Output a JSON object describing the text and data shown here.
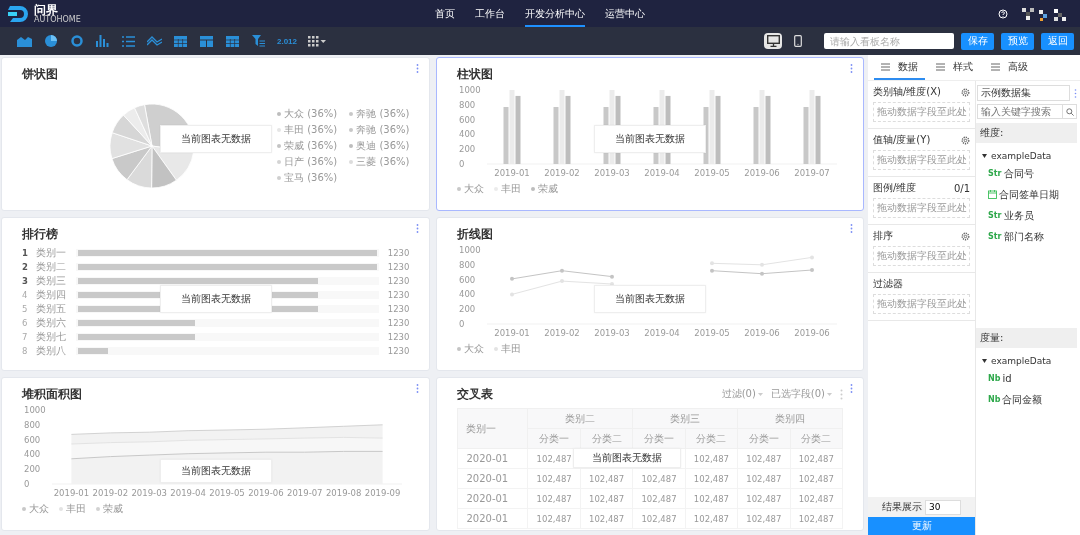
{
  "header": {
    "logo": {
      "title": "问界",
      "subtitle": "AUTOHOME"
    },
    "nav": [
      {
        "label": "首页",
        "selected": false
      },
      {
        "label": "工作台",
        "selected": false
      },
      {
        "label": "开发分析中心",
        "selected": true
      },
      {
        "label": "运营中心",
        "selected": false
      }
    ]
  },
  "toolbar": {
    "chart_types": [
      {
        "kind": "area"
      },
      {
        "kind": "pie"
      },
      {
        "kind": "donut"
      },
      {
        "kind": "bar"
      },
      {
        "kind": "list"
      },
      {
        "kind": "line"
      },
      {
        "kind": "table"
      },
      {
        "kind": "layout"
      },
      {
        "kind": "table"
      },
      {
        "kind": "filter"
      },
      {
        "kind": "number",
        "label": "2.012"
      },
      {
        "kind": "more"
      }
    ],
    "views": [
      {
        "kind": "desktop",
        "selected": true
      },
      {
        "kind": "mobile",
        "selected": false
      }
    ],
    "name_field": {
      "placeholder": "请输入看板名称"
    },
    "buttons": [
      "保存",
      "预览",
      "返回"
    ]
  },
  "panels": [
    {
      "kind": "pie",
      "title": "饼状图",
      "selected": false,
      "no_data": "当前图表无数据",
      "legend": [
        {
          "label": "大众 (36%)",
          "color": "#bdbdbd"
        },
        {
          "label": "奔驰 (36%)",
          "color": "#c8c8c8"
        },
        {
          "label": "丰田 (36%)",
          "color": "#e6e6e6"
        },
        {
          "label": "奔驰 (36%)",
          "color": "#c8c8c8"
        },
        {
          "label": "荣威 (36%)",
          "color": "#c4c4c4"
        },
        {
          "label": "奥迪 (36%)",
          "color": "#bdbdbd"
        },
        {
          "label": "日产 (36%)",
          "color": "#d4d4d4"
        },
        {
          "label": "三菱 (36%)",
          "color": "#dcdcdc"
        },
        {
          "label": "宝马 (36%)",
          "color": "#cfcfcf"
        }
      ]
    },
    {
      "kind": "bar",
      "title": "柱状图",
      "selected": true,
      "no_data": "当前图表无数据",
      "chart_data": {
        "type": "bar",
        "categories": [
          "2019-01",
          "2019-02",
          "2019-03",
          "2019-04",
          "2019-05",
          "2019-06",
          "2019-07"
        ],
        "ylim": [
          0,
          1000
        ],
        "yticks": [
          0,
          200,
          400,
          600,
          800,
          1000
        ],
        "series": [
          {
            "name": "大众",
            "color": "#c8c8c8",
            "values": [
              770,
              770,
              770,
              770,
              770,
              770,
              770
            ]
          },
          {
            "name": "丰田",
            "color": "#ebebeb",
            "values": [
              1000,
              1000,
              1000,
              1000,
              1000,
              1000,
              1000
            ]
          },
          {
            "name": "荣威",
            "color": "#bdbdbd",
            "values": [
              920,
              920,
              920,
              920,
              920,
              920,
              920
            ]
          }
        ]
      }
    },
    {
      "kind": "ranking",
      "title": "排行榜",
      "selected": false,
      "no_data": "当前图表无数据",
      "rows": [
        {
          "rank": "1",
          "label": "类别一",
          "level": 1,
          "value": "1230",
          "top": true
        },
        {
          "rank": "2",
          "label": "类别二",
          "level": 1,
          "value": "1230",
          "top": true
        },
        {
          "rank": "3",
          "label": "类别三",
          "level": 0.8,
          "value": "1230",
          "top": true
        },
        {
          "rank": "4",
          "label": "类别四",
          "level": 0.8,
          "value": "1230",
          "top": false
        },
        {
          "rank": "5",
          "label": "类别五",
          "level": 0.8,
          "value": "1230",
          "top": false
        },
        {
          "rank": "6",
          "label": "类别六",
          "level": 0.39,
          "value": "1230",
          "top": false
        },
        {
          "rank": "7",
          "label": "类别七",
          "level": 0.39,
          "value": "1230",
          "top": false
        },
        {
          "rank": "8",
          "label": "类别八",
          "level": 0.1,
          "value": "1230",
          "top": false
        }
      ]
    },
    {
      "kind": "line",
      "title": "折线图",
      "selected": false,
      "no_data": "当前图表无数据",
      "chart_data": {
        "type": "line",
        "categories": [
          "2019-01",
          "2019-02",
          "2019-03",
          "2019-04",
          "2019-05",
          "2019-06",
          "2019-06"
        ],
        "ylim": [
          0,
          1000
        ],
        "yticks": [
          0,
          200,
          400,
          600,
          800,
          1000
        ],
        "series": [
          {
            "name": "大众",
            "color": "#c4c4c4",
            "values": [
              610,
              720,
              640,
              null,
              720,
              680,
              730
            ]
          },
          {
            "name": "丰田",
            "color": "#e3e3e3",
            "values": [
              400,
              580,
              540,
              null,
              820,
              800,
              900
            ]
          }
        ]
      }
    },
    {
      "kind": "area",
      "title": "堆积面积图",
      "selected": false,
      "no_data": "当前图表无数据",
      "chart_data": {
        "type": "area",
        "categories": [
          "2019-01",
          "2019-02",
          "2019-03",
          "2019-04",
          "2019-05",
          "2019-06",
          "2019-07",
          "2019-08",
          "2019-09"
        ],
        "ylim": [
          0,
          1000
        ],
        "yticks": [
          0,
          200,
          400,
          600,
          800,
          1000
        ],
        "series": [
          {
            "name": "大众",
            "color": "#c8c8c8",
            "values": [
              340,
              370,
              390,
              410,
              420,
              430,
              430,
              440,
              440
            ]
          },
          {
            "name": "丰田",
            "color": "#e3e3e3",
            "values": [
              540,
              560,
              570,
              590,
              600,
              610,
              620,
              630,
              620
            ]
          },
          {
            "name": "荣威",
            "color": "#d2d2d2",
            "values": [
              670,
              690,
              700,
              720,
              730,
              740,
              760,
              780,
              800
            ]
          }
        ]
      }
    },
    {
      "kind": "crosstab",
      "title": "交叉表",
      "selected": false,
      "no_data": "当前图表无数据",
      "filters": [
        "过滤(0)",
        "已选字段(0)"
      ],
      "table": {
        "corner": "类别一",
        "groups": [
          "类别二",
          "类别三",
          "类别四"
        ],
        "columns": [
          "分类一",
          "分类二",
          "分类一",
          "分类二",
          "分类一",
          "分类二"
        ],
        "rows": [
          {
            "label": "2020-01",
            "cells": [
              "102,487",
              null,
              null,
              "102,487",
              "102,487",
              "102,487"
            ]
          },
          {
            "label": "2020-01",
            "cells": [
              "102,487",
              "102,487",
              "102,487",
              "102,487",
              "102,487",
              "102,487"
            ]
          },
          {
            "label": "2020-01",
            "cells": [
              "102,487",
              "102,487",
              "102,487",
              "102,487",
              "102,487",
              "102,487"
            ]
          },
          {
            "label": "2020-01",
            "cells": [
              "102,487",
              "102,487",
              "102,487",
              "102,487",
              "102,487",
              "102,487"
            ]
          }
        ]
      }
    }
  ],
  "config": {
    "tabs": [
      {
        "label": "数据",
        "selected": true
      },
      {
        "label": "样式",
        "selected": false
      },
      {
        "label": "高级",
        "selected": false
      }
    ],
    "sections": [
      {
        "kind": "gear",
        "title": "类别轴/维度(X)",
        "drop": "拖动数据字段至此处"
      },
      {
        "kind": "gear",
        "title": "值轴/度量(Y)",
        "drop": "拖动数据字段至此处"
      },
      {
        "kind": "count",
        "title": "图例/维度",
        "count": "0/1",
        "drop": "拖动数据字段至此处"
      },
      {
        "kind": "gear",
        "title": "排序",
        "drop": "拖动数据字段至此处"
      },
      {
        "kind": "plain",
        "title": "过滤器",
        "drop": "拖动数据字段至此处"
      }
    ],
    "result": {
      "label": "结果展示",
      "value": "30"
    },
    "update": "更新"
  },
  "dataset": {
    "value": "示例数据集",
    "search_placeholder": "输入关键字搜索",
    "groups": [
      {
        "title": "维度:",
        "tree": [
          {
            "label": "exampleData",
            "expanded": true,
            "children": [
              {
                "kind": "str",
                "tag": "Str",
                "label": "合同号"
              },
              {
                "kind": "date",
                "label": "合同签单日期"
              },
              {
                "kind": "str",
                "tag": "Str",
                "label": "业务员"
              },
              {
                "kind": "str",
                "tag": "Str",
                "label": "部门名称"
              }
            ]
          }
        ]
      },
      {
        "title": "度量:",
        "tree": [
          {
            "label": "exampleData",
            "expanded": true,
            "children": [
              {
                "kind": "num",
                "tag": "Nb",
                "label": "id"
              },
              {
                "kind": "num",
                "tag": "Nb",
                "label": "合同金额"
              }
            ]
          }
        ]
      }
    ]
  }
}
